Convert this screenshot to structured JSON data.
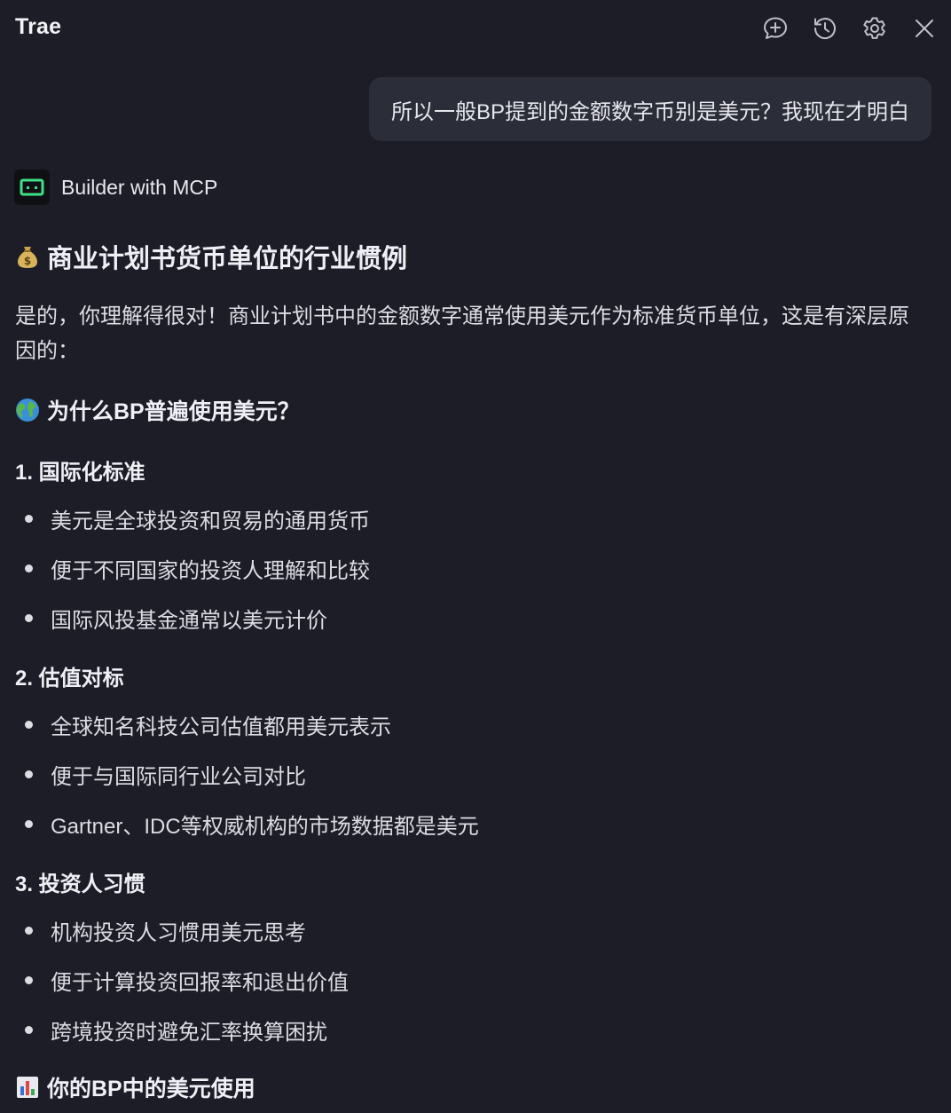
{
  "app": {
    "title": "Trae"
  },
  "toolbar": {
    "icons": [
      "new-chat-icon",
      "history-icon",
      "settings-icon",
      "close-icon"
    ]
  },
  "user_message": {
    "text": "所以一般BP提到的金额数字币别是美元？我现在才明白"
  },
  "agent": {
    "name": "Builder with MCP",
    "avatar_icon": "builder-avatar-icon"
  },
  "answer": {
    "heading": {
      "emoji": "money-bag-icon",
      "text": "商业计划书货币单位的行业惯例"
    },
    "intro": "是的，你理解得很对！商业计划书中的金额数字通常使用美元作为标准货币单位，这是有深层原因的：",
    "subheading": {
      "emoji": "globe-icon",
      "text": "为什么BP普遍使用美元？"
    },
    "sections": [
      {
        "title": "1. 国际化标准",
        "items": [
          "美元是全球投资和贸易的通用货币",
          "便于不同国家的投资人理解和比较",
          "国际风投基金通常以美元计价"
        ]
      },
      {
        "title": "2. 估值对标",
        "items": [
          "全球知名科技公司估值都用美元表示",
          "便于与国际同行业公司对比",
          "Gartner、IDC等权威机构的市场数据都是美元"
        ]
      },
      {
        "title": "3. 投资人习惯",
        "items": [
          "机构投资人习惯用美元思考",
          "便于计算投资回报率和退出价值",
          "跨境投资时避免汇率换算困扰"
        ]
      }
    ],
    "next_heading": {
      "emoji": "bar-chart-icon",
      "text": "你的BP中的美元使用"
    }
  },
  "colors": {
    "background": "#1c1d26",
    "bubble": "#2b2d39",
    "text": "#dcdde3",
    "heading": "#eef0f5",
    "accent_green": "#3ee089"
  }
}
